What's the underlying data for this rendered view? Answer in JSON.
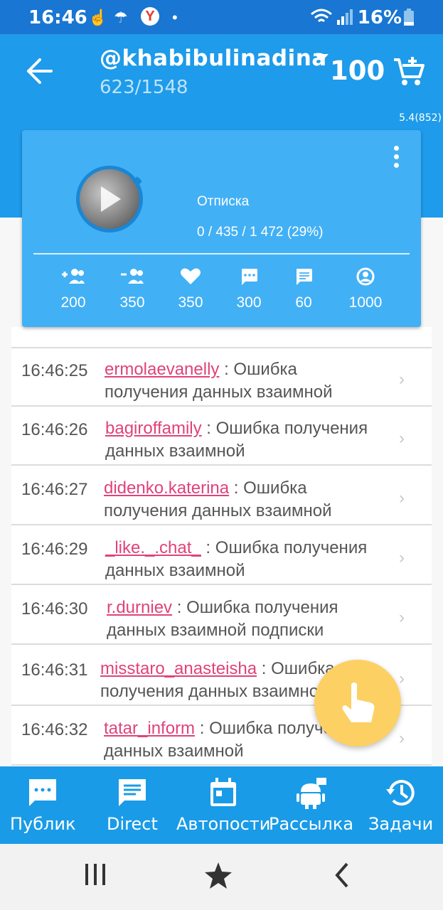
{
  "status_bar": {
    "time": "16:46",
    "battery": "16%"
  },
  "header": {
    "account": "@khabibulinadina",
    "counts": "623/1548",
    "credits": "100",
    "version": "5.4(852)"
  },
  "task_card": {
    "label": "Отписка",
    "progress": "0 / 435 / 1 472 (29%)",
    "stats": [
      "200",
      "350",
      "350",
      "300",
      "60",
      "1000"
    ]
  },
  "log": [
    {
      "time": "16:46:25",
      "user": "ermolaevanelly",
      "message": " : Ошибка получения данных взаимной"
    },
    {
      "time": "16:46:26",
      "user": "bagiroffamily",
      "message": " : Ошибка получения данных взаимной"
    },
    {
      "time": "16:46:27",
      "user": "didenko.katerina",
      "message": " : Ошибка получения данных взаимной"
    },
    {
      "time": "16:46:29",
      "user": "_like._.chat_",
      "message": " : Ошибка получения данных взаимной"
    },
    {
      "time": "16:46:30",
      "user": "r.durniev",
      "message": " : Ошибка получения данных взаимной подписки"
    },
    {
      "time": "16:46:31",
      "user": "misstaro_anasteisha",
      "message": " : Ошибка получения данных взаимной"
    },
    {
      "time": "16:46:32",
      "user": "tatar_inform",
      "message": " : Ошибка получения данных взаимной"
    }
  ],
  "bottom_nav": {
    "public": "Публик",
    "direct": "Direct",
    "autopost": "Автопости",
    "mailing": "Рассылка",
    "tasks": "Задачи"
  },
  "colors": {
    "primary": "#1e9bea",
    "card": "#42b0f5",
    "username": "#e0427a",
    "fab": "#fcd063"
  }
}
